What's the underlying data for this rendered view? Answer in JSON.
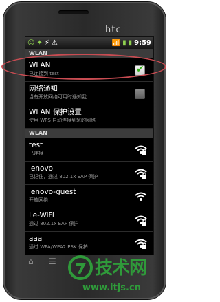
{
  "device": {
    "brand": "htc"
  },
  "status_bar": {
    "time": "9:59"
  },
  "sections": {
    "top_header": "WLAN",
    "networks_header": "WLAN"
  },
  "settings": [
    {
      "title": "WLAN",
      "subtitle": "已连接到 test",
      "checked": true
    },
    {
      "title": "网络通知",
      "subtitle": "当有开放网络可用时通知我",
      "checked": false
    },
    {
      "title": "WLAN 保护设置",
      "subtitle": "使用 WPS 自动连接到您的网络"
    }
  ],
  "networks": [
    {
      "ssid": "test",
      "status": "已连接",
      "secured": true
    },
    {
      "ssid": "lenovo",
      "status": "已记住，通过 802.1x EAP 保护",
      "secured": true
    },
    {
      "ssid": "lenovo-guest",
      "status": "开放网络",
      "secured": false
    },
    {
      "ssid": "Le-WiFi",
      "status": "通过 802.1x EAP 保护",
      "secured": true
    },
    {
      "ssid": "aaa",
      "status": "通过 WPA/WPA2 PSK 保护",
      "secured": true
    }
  ],
  "watermark": {
    "brand": "技术网",
    "url": "www.itjs.cn"
  },
  "colors": {
    "highlight": "#c94c52",
    "check": "#36b21a",
    "watermark": "#2f9a3a"
  }
}
